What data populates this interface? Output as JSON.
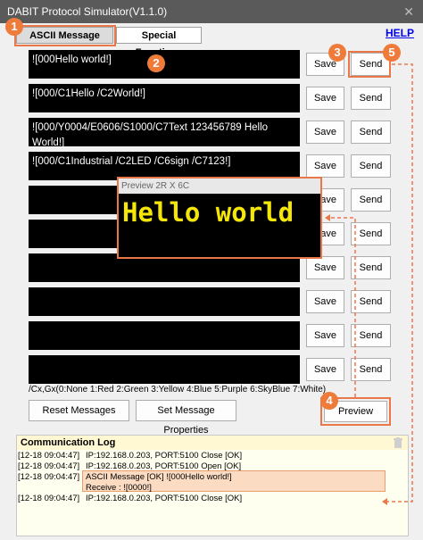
{
  "window": {
    "title": "DABIT Protocol Simulator(V1.1.0)",
    "close_glyph": "✕"
  },
  "tabs": [
    {
      "label": "ASCII Message",
      "active": true
    },
    {
      "label": "Special Functions",
      "active": false
    }
  ],
  "help_label": "HELP",
  "messages": [
    {
      "text": "![000Hello world!]"
    },
    {
      "text": "![000/C1Hello /C2World!]"
    },
    {
      "text": "![000/Y0004/E0606/S1000/C7Text 123456789 Hello World!]"
    },
    {
      "text": "![000/C1Industrial  /C2LED /C6sign /C7123!]"
    },
    {
      "text": ""
    },
    {
      "text": ""
    },
    {
      "text": ""
    },
    {
      "text": ""
    },
    {
      "text": ""
    },
    {
      "text": ""
    }
  ],
  "buttons": {
    "save_label": "Save",
    "send_label": "Send",
    "reset_label": "Reset Messages",
    "props_label": "Set Message Properties",
    "preview_label": "Preview"
  },
  "color_legend": "/Cx,Gx(0:None 1:Red 2:Green 3:Yellow 4:Blue 5:Purple 6:SkyBlue 7:White)",
  "preview": {
    "title": "Preview 2R X 6C",
    "text": "Hello world",
    "text_color": "#f5e60a"
  },
  "log": {
    "title": "Communication Log",
    "lines": [
      {
        "ts": "[12-18 09:04:47]",
        "msg": "IP:192.168.0.203, PORT:5100 Close [OK]"
      },
      {
        "ts": "[12-18 09:04:47]",
        "msg": "IP:192.168.0.203, PORT:5100 Open [OK]"
      },
      {
        "ts": "[12-18 09:04:47]",
        "msg": "ASCII Message [OK] ![000Hello world!]"
      },
      {
        "ts": "",
        "msg": "Receive : ![0000!]"
      },
      {
        "ts": "[12-18 09:04:47]",
        "msg": "IP:192.168.0.203, PORT:5100 Close [OK]"
      }
    ]
  },
  "callouts": [
    "1",
    "2",
    "3",
    "4",
    "5"
  ],
  "accent_color": "#e8784a"
}
